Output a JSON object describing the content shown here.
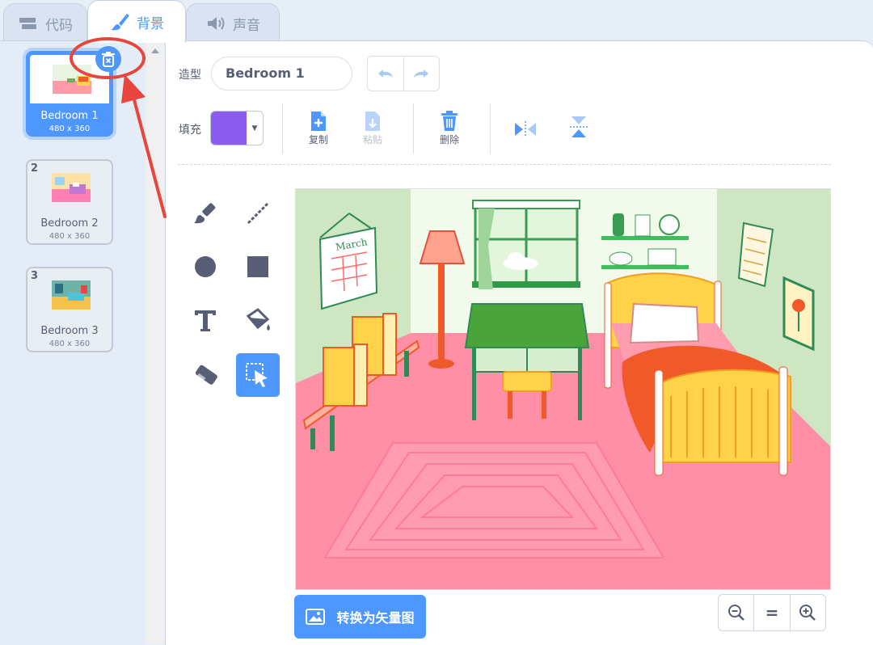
{
  "tabs": [
    {
      "label": "代码",
      "icon": "code-blocks-icon"
    },
    {
      "label": "背景",
      "icon": "paintbrush-icon"
    },
    {
      "label": "声音",
      "icon": "speaker-icon"
    }
  ],
  "costumes": [
    {
      "number": "1",
      "name": "Bedroom 1",
      "size": "480 x 360"
    },
    {
      "number": "2",
      "name": "Bedroom 2",
      "size": "480 x 360"
    },
    {
      "number": "3",
      "name": "Bedroom 3",
      "size": "480 x 360"
    }
  ],
  "editor": {
    "costume_label": "造型",
    "costume_name": "Bedroom 1",
    "fill_label": "填充",
    "fill_color": "#8c5cf0",
    "copy_label": "复制",
    "paste_label": "粘贴",
    "delete_label": "删除",
    "convert_label": "转换为矢量图"
  },
  "colors": {
    "accent": "#4d97ff",
    "annotation": "#e8453c"
  },
  "tools": [
    "brush-icon",
    "line-icon",
    "circle-icon",
    "rectangle-icon",
    "text-icon",
    "fill-bucket-icon",
    "eraser-icon",
    "select-icon"
  ],
  "zoom": {
    "out": "zoom-out-icon",
    "reset": "=",
    "in": "zoom-in-icon"
  }
}
